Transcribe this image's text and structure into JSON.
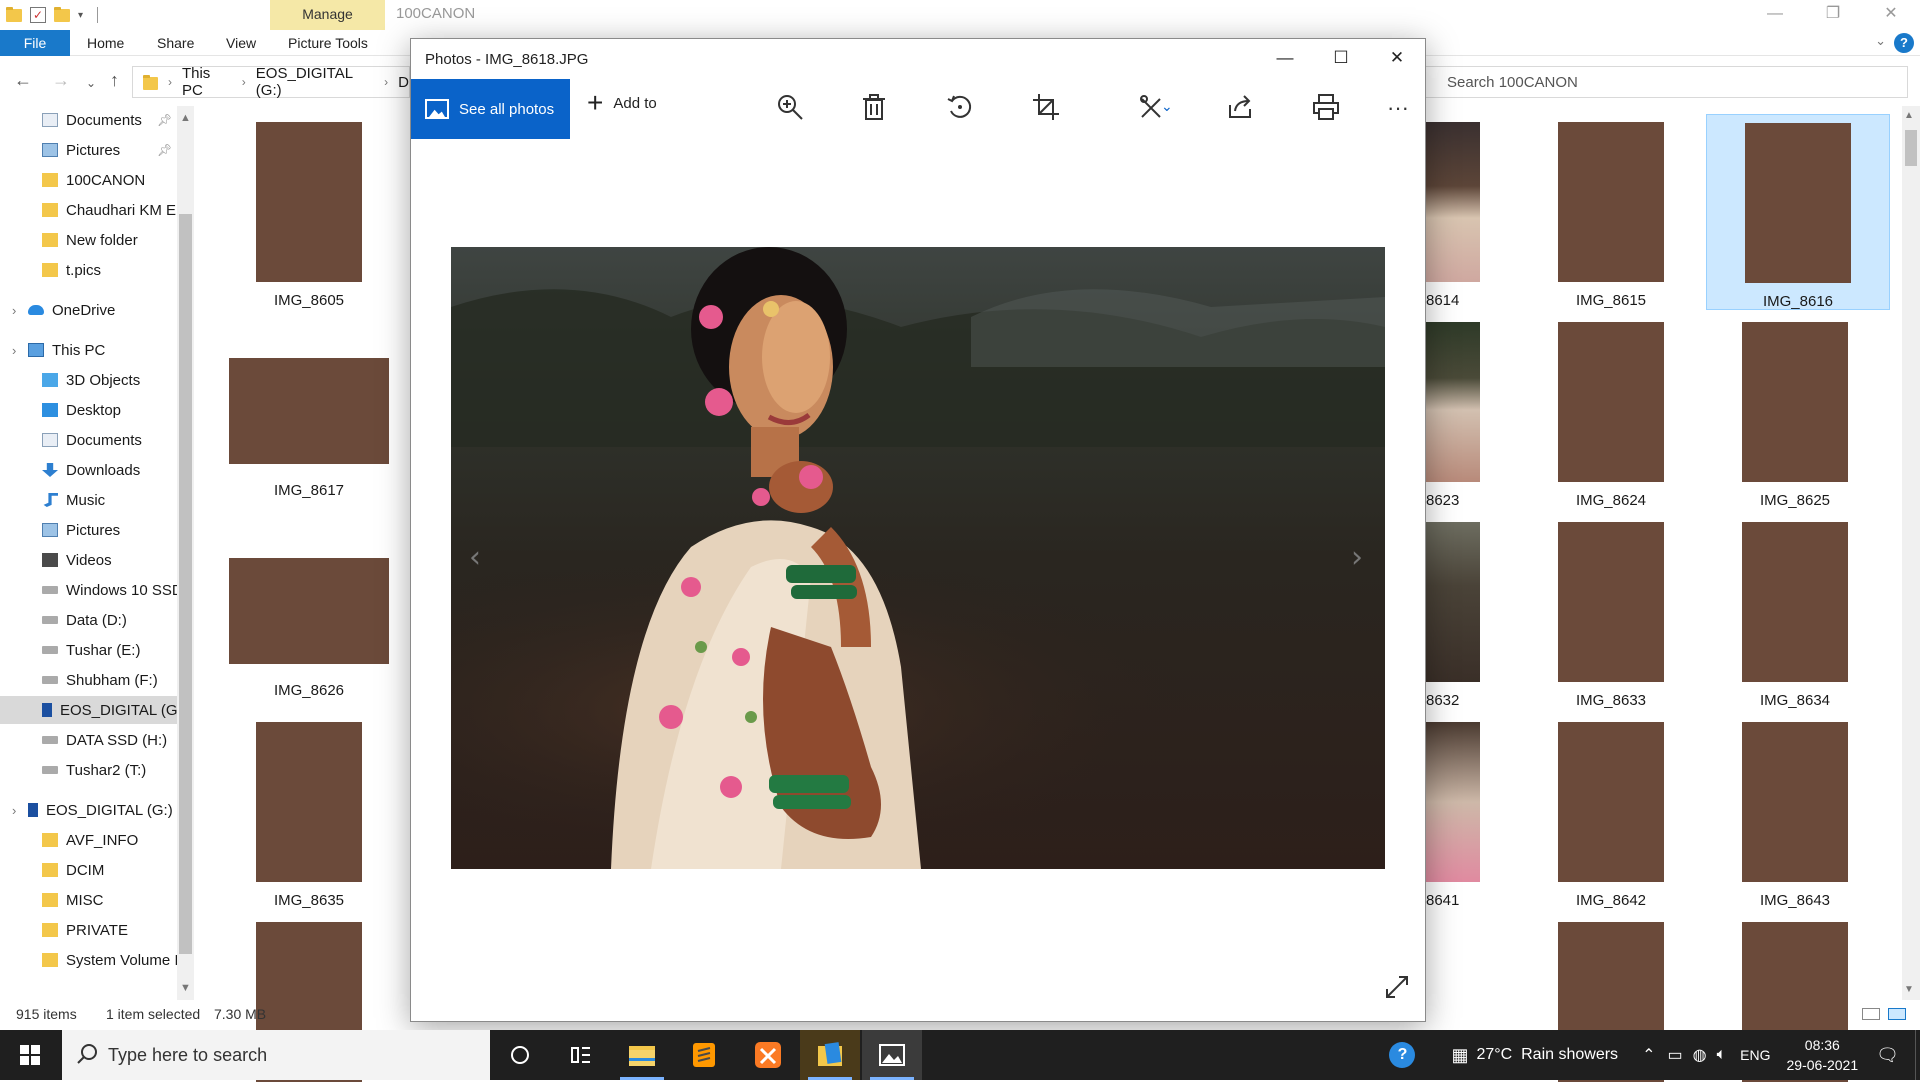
{
  "explorer": {
    "window_title": "100CANON",
    "manage_tab": "Manage",
    "ribbon_tabs": [
      "File",
      "Home",
      "Share",
      "View",
      "Picture Tools"
    ],
    "breadcrumb": [
      "This PC",
      "EOS_DIGITAL (G:)",
      "D"
    ],
    "search_placeholder": "Search 100CANON",
    "sidebar": [
      {
        "label": "Documents",
        "icon": "documents-icon",
        "pinned": true
      },
      {
        "label": "Pictures",
        "icon": "pictures-icon",
        "pinned": true
      },
      {
        "label": "100CANON",
        "icon": "folder-icon"
      },
      {
        "label": "Chaudhari KM Er",
        "icon": "folder-icon"
      },
      {
        "label": "New folder",
        "icon": "folder-icon"
      },
      {
        "label": "t.pics",
        "icon": "folder-icon"
      },
      {
        "label": "OneDrive",
        "icon": "onedrive-icon"
      },
      {
        "label": "This PC",
        "icon": "this-pc-icon"
      },
      {
        "label": "3D Objects",
        "icon": "3d-objects-icon"
      },
      {
        "label": "Desktop",
        "icon": "desktop-icon"
      },
      {
        "label": "Documents",
        "icon": "documents-icon"
      },
      {
        "label": "Downloads",
        "icon": "downloads-icon"
      },
      {
        "label": "Music",
        "icon": "music-icon"
      },
      {
        "label": "Pictures",
        "icon": "pictures-icon"
      },
      {
        "label": "Videos",
        "icon": "videos-icon"
      },
      {
        "label": "Windows 10 SSD",
        "icon": "drive-icon"
      },
      {
        "label": "Data (D:)",
        "icon": "drive-icon"
      },
      {
        "label": "Tushar (E:)",
        "icon": "drive-icon"
      },
      {
        "label": "Shubham (F:)",
        "icon": "drive-icon"
      },
      {
        "label": "EOS_DIGITAL (G:",
        "icon": "usb-drive-icon",
        "selected": true
      },
      {
        "label": "DATA SSD (H:)",
        "icon": "drive-icon"
      },
      {
        "label": "Tushar2 (T:)",
        "icon": "drive-icon"
      },
      {
        "label": "EOS_DIGITAL (G:)",
        "icon": "usb-drive-icon"
      },
      {
        "label": "AVF_INFO",
        "icon": "folder-icon"
      },
      {
        "label": "DCIM",
        "icon": "folder-icon"
      },
      {
        "label": "MISC",
        "icon": "folder-icon"
      },
      {
        "label": "PRIVATE",
        "icon": "folder-icon"
      },
      {
        "label": "System Volume I",
        "icon": "folder-icon"
      }
    ],
    "files_left": [
      "IMG_8605",
      "IMG_8617",
      "IMG_8626",
      "IMG_8635",
      ""
    ],
    "files_partial": [
      "8614",
      "8623",
      "8632",
      "8641"
    ],
    "files_col4": [
      "IMG_8615",
      "IMG_8624",
      "IMG_8633",
      "IMG_8642",
      ""
    ],
    "files_col5": [
      "IMG_8616",
      "IMG_8625",
      "IMG_8634",
      "IMG_8643",
      ""
    ],
    "status": {
      "count": "915 items",
      "selected": "1 item selected",
      "size": "7.30 MB"
    }
  },
  "photos": {
    "title": "Photos - IMG_8618.JPG",
    "see_all": "See all photos",
    "add_to": "Add to"
  },
  "taskbar": {
    "search_placeholder": "Type here to search",
    "weather": "27°C  Rain showers",
    "lang": "ENG",
    "time": "08:36",
    "date": "29-06-2021"
  }
}
